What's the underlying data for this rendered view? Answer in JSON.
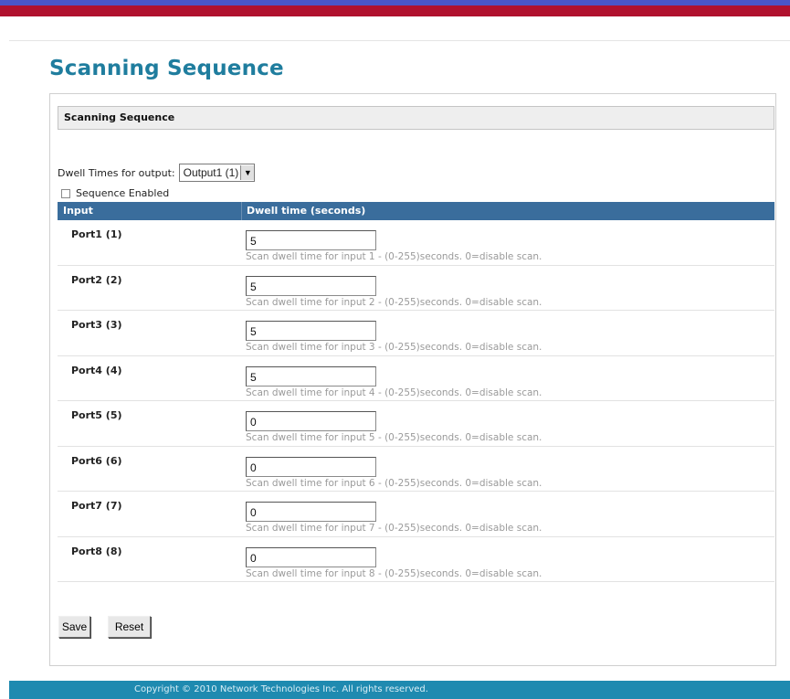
{
  "page": {
    "title": "Scanning Sequence"
  },
  "panel": {
    "header": "Scanning Sequence",
    "dwell_label": "Dwell Times for output:",
    "output_select": {
      "selected": "Output1 (1)"
    },
    "sequence_enabled": {
      "label": "Sequence Enabled",
      "checked": false
    }
  },
  "table": {
    "headers": [
      "Input",
      "Dwell time (seconds)"
    ],
    "rows": [
      {
        "port": "Port1 (1)",
        "value": "5",
        "hint": "Scan dwell time for input 1 - (0-255)seconds. 0=disable scan."
      },
      {
        "port": "Port2 (2)",
        "value": "5",
        "hint": "Scan dwell time for input 2 - (0-255)seconds. 0=disable scan."
      },
      {
        "port": "Port3 (3)",
        "value": "5",
        "hint": "Scan dwell time for input 3 - (0-255)seconds. 0=disable scan."
      },
      {
        "port": "Port4 (4)",
        "value": "5",
        "hint": "Scan dwell time for input 4 - (0-255)seconds. 0=disable scan."
      },
      {
        "port": "Port5 (5)",
        "value": "0",
        "hint": "Scan dwell time for input 5 - (0-255)seconds. 0=disable scan."
      },
      {
        "port": "Port6 (6)",
        "value": "0",
        "hint": "Scan dwell time for input 6 - (0-255)seconds. 0=disable scan."
      },
      {
        "port": "Port7 (7)",
        "value": "0",
        "hint": "Scan dwell time for input 7 - (0-255)seconds. 0=disable scan."
      },
      {
        "port": "Port8 (8)",
        "value": "0",
        "hint": "Scan dwell time for input 8 - (0-255)seconds. 0=disable scan."
      }
    ]
  },
  "buttons": {
    "save": "Save",
    "reset": "Reset"
  },
  "footer": {
    "copyright": "Copyright © 2010 Network Technologies Inc. All rights reserved."
  },
  "colors": {
    "title": "#1f7d9e",
    "table_header": "#3a6d9c",
    "footer": "#1f8ab0",
    "top_stripe_blue": "#4a56c8",
    "top_stripe_red": "#b0112e"
  },
  "icons": {
    "select_arrow": "chevron-down-icon",
    "checkbox": "checkbox-unchecked"
  }
}
